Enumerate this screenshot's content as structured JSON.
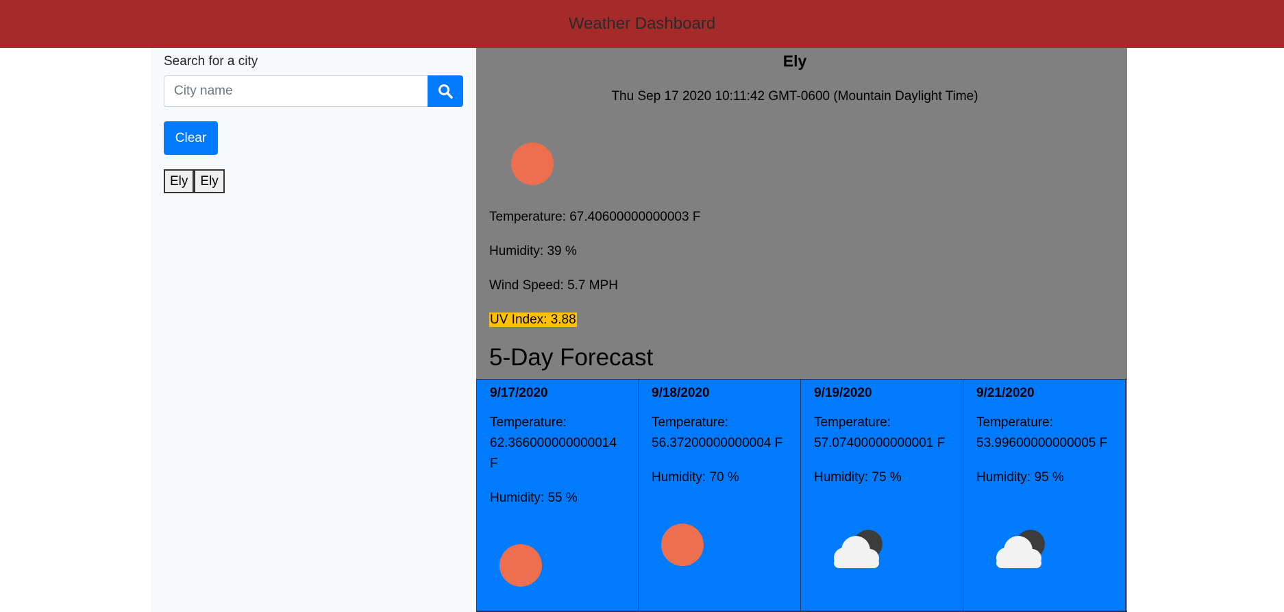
{
  "header": {
    "title": "Weather Dashboard"
  },
  "sidebar": {
    "search_label": "Search for a city",
    "search_placeholder": "City name",
    "search_value": "",
    "clear_label": "Clear",
    "history": [
      "Ely",
      "Ely"
    ]
  },
  "current": {
    "city": "Ely",
    "datetime": "Thu Sep 17 2020 10:11:42 GMT-0600 (Mountain Daylight Time)",
    "icon": "sun-icon",
    "temperature": "Temperature: 67.40600000000003 F",
    "humidity": "Humidity: 39 %",
    "wind": "Wind Speed: 5.7 MPH",
    "uv": "UV Index: 3.88"
  },
  "forecast": {
    "title": "5-Day Forecast",
    "days": [
      {
        "date": "9/17/2020",
        "temperature": "Temperature: 62.366000000000014 F",
        "humidity": "Humidity: 55 %",
        "icon": "sun-icon"
      },
      {
        "date": "9/18/2020",
        "temperature": "Temperature: 56.37200000000004 F",
        "humidity": "Humidity: 70 %",
        "icon": "sun-icon"
      },
      {
        "date": "9/19/2020",
        "temperature": "Temperature: 57.07400000000001 F",
        "humidity": "Humidity: 75 %",
        "icon": "cloud-moon-icon"
      },
      {
        "date": "9/21/2020",
        "temperature": "Temperature: 53.99600000000005 F",
        "humidity": "Humidity: 95 %",
        "icon": "cloud-moon-icon"
      }
    ]
  },
  "colors": {
    "header": "#a52a2a",
    "sidebar": "#f8f9fa",
    "main": "#808080",
    "forecast_card": "#007bff",
    "button": "#007bff",
    "uv_badge": "#ffc107",
    "sun": "#ed6f4e"
  }
}
